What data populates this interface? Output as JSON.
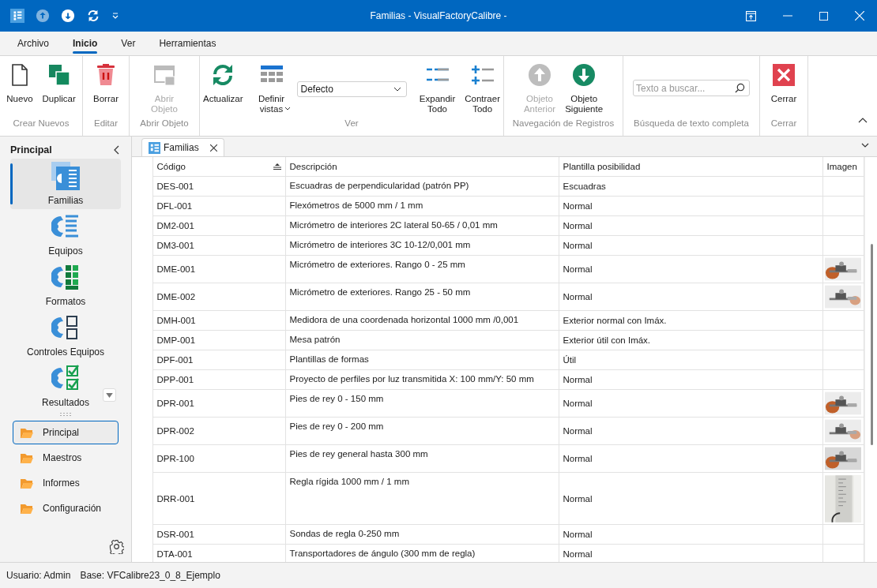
{
  "window": {
    "title": "Familias - VisualFactoryCalibre -"
  },
  "quick_access": [
    {
      "disabled": true
    },
    {
      "disabled": false
    },
    {
      "disabled": false
    }
  ],
  "menu_tabs": [
    {
      "label": "Archivo",
      "selected": false
    },
    {
      "label": "Inicio",
      "selected": true
    },
    {
      "label": "Ver",
      "selected": false
    },
    {
      "label": "Herramientas",
      "selected": false
    }
  ],
  "ribbon": {
    "groups": [
      {
        "label": "Crear Nuevos",
        "items": [
          {
            "kind": "button",
            "label_lines": [
              "Nuevo"
            ],
            "disabled": false
          },
          {
            "kind": "button",
            "label_lines": [
              "Duplicar"
            ],
            "disabled": false
          }
        ]
      },
      {
        "label": "Editar",
        "items": [
          {
            "kind": "button",
            "label_lines": [
              "Borrar"
            ],
            "disabled": false
          }
        ]
      },
      {
        "label": "Abrir Objeto",
        "items": [
          {
            "kind": "button",
            "label_lines": [
              "Abrir",
              "Objeto"
            ],
            "disabled": true
          }
        ]
      },
      {
        "label": "Ver",
        "items": [
          {
            "kind": "button",
            "label_lines": [
              "Actualizar"
            ],
            "disabled": false
          },
          {
            "kind": "menu-button",
            "label_lines": [
              "Definir",
              "vistas"
            ],
            "disabled": false
          },
          {
            "kind": "dropdown",
            "value": "Defecto"
          },
          {
            "kind": "button",
            "label_lines": [
              "Expandir",
              "Todo"
            ],
            "disabled": false
          },
          {
            "kind": "button",
            "label_lines": [
              "Contraer",
              "Todo"
            ],
            "disabled": false
          }
        ]
      },
      {
        "label": "Navegación de Registros",
        "items": [
          {
            "kind": "button",
            "label_lines": [
              "Objeto",
              "Anterior"
            ],
            "disabled": true
          },
          {
            "kind": "button",
            "label_lines": [
              "Objeto",
              "Siguiente"
            ],
            "disabled": false
          }
        ]
      },
      {
        "label": "Búsqueda de texto completa",
        "items": [
          {
            "kind": "search",
            "placeholder": "Texto a buscar..."
          }
        ]
      },
      {
        "label": "Cerrar",
        "items": [
          {
            "kind": "button",
            "label_lines": [
              "Cerrar"
            ],
            "disabled": false
          }
        ]
      }
    ]
  },
  "sidebar": {
    "title": "Principal",
    "nav_items": [
      {
        "label": "Familias",
        "selected": true
      },
      {
        "label": "Equipos",
        "selected": false
      },
      {
        "label": "Formatos",
        "selected": false
      },
      {
        "label": "Controles Equipos",
        "selected": false
      },
      {
        "label": "Resultados",
        "selected": false
      }
    ],
    "groups": [
      {
        "label": "Principal",
        "selected": true
      },
      {
        "label": "Maestros",
        "selected": false
      },
      {
        "label": "Informes",
        "selected": false
      },
      {
        "label": "Configuración",
        "selected": false
      }
    ]
  },
  "document_tabs": [
    {
      "label": "Familias",
      "selected": true
    }
  ],
  "table": {
    "columns": [
      {
        "label": "Código",
        "sorted": true
      },
      {
        "label": "Descripción",
        "sorted": false
      },
      {
        "label": "Plantilla posibilidad",
        "sorted": false
      },
      {
        "label": "Imagen",
        "sorted": false
      }
    ],
    "rows": [
      {
        "code": "DES-001",
        "description": "Escuadras de perpendicularidad (patrón PP)",
        "template": "Escuadras"
      },
      {
        "code": "DFL-001",
        "description": "Flexómetros de 5000 mm / 1 mm",
        "template": "Normal"
      },
      {
        "code": "DM2-001",
        "description": "Micrómetro de interiores 2C lateral 50-65 / 0,01 mm",
        "template": "Normal"
      },
      {
        "code": "DM3-001",
        "description": "Micrómetro de interiores 3C 10-12/0,001 mm",
        "template": "Normal"
      },
      {
        "code": "DME-001",
        "description": "Micrómetro de exteriores. Rango 0 - 25 mm",
        "template": "Normal"
      },
      {
        "code": "DME-002",
        "description": "Micrómetro de exteriores. Rango 25 - 50 mm",
        "template": "Normal"
      },
      {
        "code": "DMH-001",
        "description": "Medidora de una coordenada horizontal 1000 mm /0,001",
        "template": "Exterior normal con Imáx."
      },
      {
        "code": "DMP-001",
        "description": "Mesa patrón",
        "template": "Exterior útil con Imáx."
      },
      {
        "code": "DPF-001",
        "description": "Plantillas de formas",
        "template": "Útil"
      },
      {
        "code": "DPP-001",
        "description": "Proyecto de perfiles por luz transmitida X: 100 mm/Y: 50 mm",
        "template": "Normal"
      },
      {
        "code": "DPR-001",
        "description": "Pies de rey 0 - 150 mm",
        "template": "Normal"
      },
      {
        "code": "DPR-002",
        "description": "Pies de rey 0 - 200 mm",
        "template": "Normal"
      },
      {
        "code": "DPR-100",
        "description": "Pies de rey general hasta 300 mm",
        "template": "Normal"
      },
      {
        "code": "DRR-001",
        "description": "Regla rígida 1000 mm / 1 mm",
        "template": "Normal",
        "kind": "tall-image"
      },
      {
        "code": "DSR-001",
        "description": "Sondas de regla 0-250 mm",
        "template": "Normal"
      },
      {
        "code": "DTA-001",
        "description": "Transportadores de ángulo (300 mm de regla)",
        "template": "Normal"
      }
    ]
  },
  "status_bar": {
    "user": "Usuario: Admin",
    "database": "Base: VFCalibre23_0_8_Ejemplo"
  }
}
